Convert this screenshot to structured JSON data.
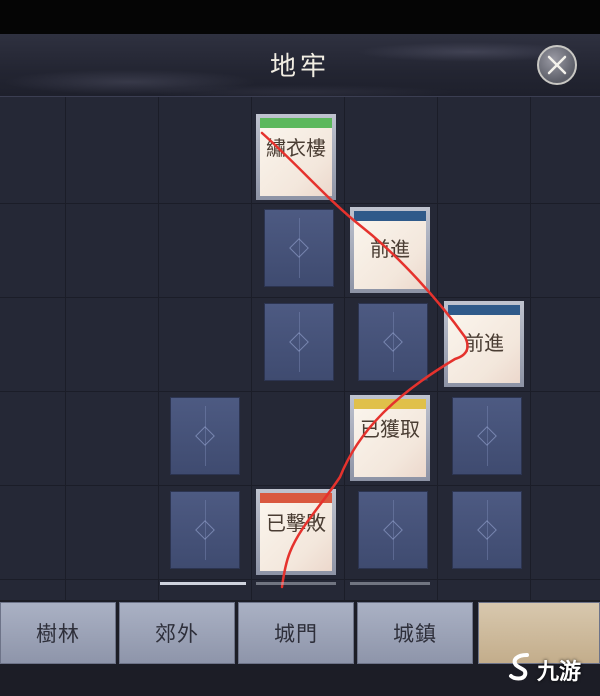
{
  "header": {
    "title": "地牢"
  },
  "board": {
    "cards": [
      {
        "label": "繡衣樓",
        "strip_color": "#5cb85c"
      },
      {
        "label": "前進",
        "strip_color": "#2f5a8a"
      },
      {
        "label": "前進",
        "strip_color": "#2f5a8a"
      },
      {
        "label": "已獲取",
        "strip_color": "#e0c04a"
      },
      {
        "label": "已擊敗",
        "strip_color": "#d9583f"
      }
    ],
    "path_color": "#e5322d"
  },
  "tabs": [
    {
      "label": "樹林"
    },
    {
      "label": "郊外"
    },
    {
      "label": "城門"
    },
    {
      "label": "城鎮"
    },
    {
      "label": ""
    }
  ],
  "watermark": {
    "text": "九游"
  }
}
